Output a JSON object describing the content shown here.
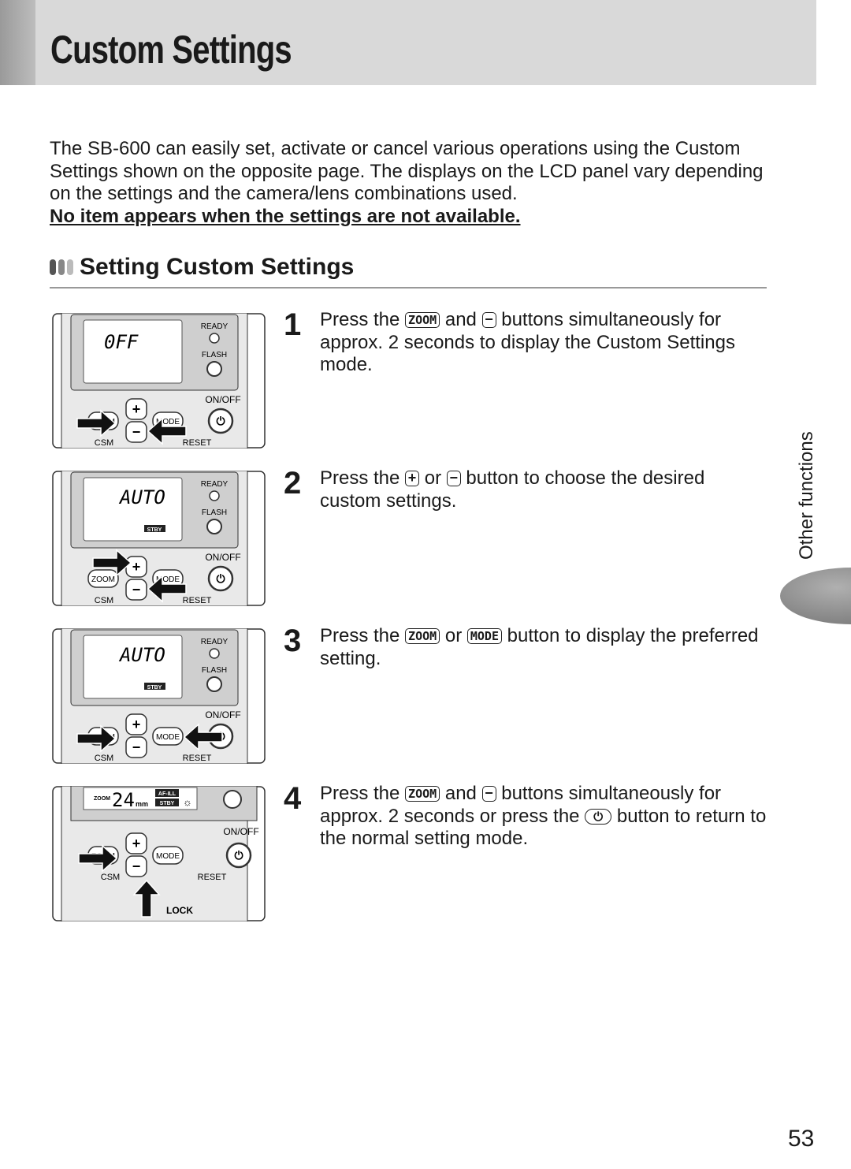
{
  "header": {
    "title": "Custom Settings"
  },
  "intro": {
    "text": "The SB-600 can easily set, activate or cancel various operations using the Custom Settings shown on the opposite page. The displays on the LCD panel vary depending on the settings and the camera/lens combinations used.",
    "note": "No item appears when the settings are not available."
  },
  "section": {
    "title": "Setting Custom Settings",
    "bar_colors": [
      "#555555",
      "#888888",
      "#bbbbbb"
    ]
  },
  "buttons": {
    "zoom": "ZOOM",
    "mode": "MODE",
    "minus": "−",
    "plus": "+",
    "power": "⏻"
  },
  "steps": [
    {
      "num": "1",
      "parts": [
        "Press the ",
        "zoom",
        " and ",
        "minus",
        " buttons simultaneously for approx. 2 seconds to display the Custom Settings mode."
      ]
    },
    {
      "num": "2",
      "parts": [
        "Press the ",
        "plus",
        " or ",
        "minus",
        " button to choose the desired custom settings."
      ]
    },
    {
      "num": "3",
      "parts": [
        "Press the ",
        "zoom",
        " or ",
        "mode",
        " button to display the preferred setting."
      ]
    },
    {
      "num": "4",
      "parts": [
        "Press the ",
        "zoom",
        " and ",
        "minus",
        " buttons simultaneously for approx. 2 seconds or press the ",
        "power",
        " button to return to the normal setting mode."
      ]
    }
  ],
  "panel_labels": {
    "ready": "READY",
    "flash": "FLASH",
    "onoff": "ON/OFF",
    "zoom": "ZOOM",
    "mode": "MODE",
    "csm": "CSM",
    "reset": "RESET",
    "lock": "LOCK"
  },
  "panels": [
    {
      "lcd": "0FF",
      "badge": ""
    },
    {
      "lcd": "AUTO",
      "badge": "STBY"
    },
    {
      "lcd": "AUTO",
      "badge": "STBY"
    },
    {
      "lcd_zoom": "ZOOM",
      "lcd": "24",
      "unit": "mm",
      "badge": "STBY",
      "badge2": "AF-ILL"
    }
  ],
  "side_tab": "Other functions",
  "page_number": "53"
}
